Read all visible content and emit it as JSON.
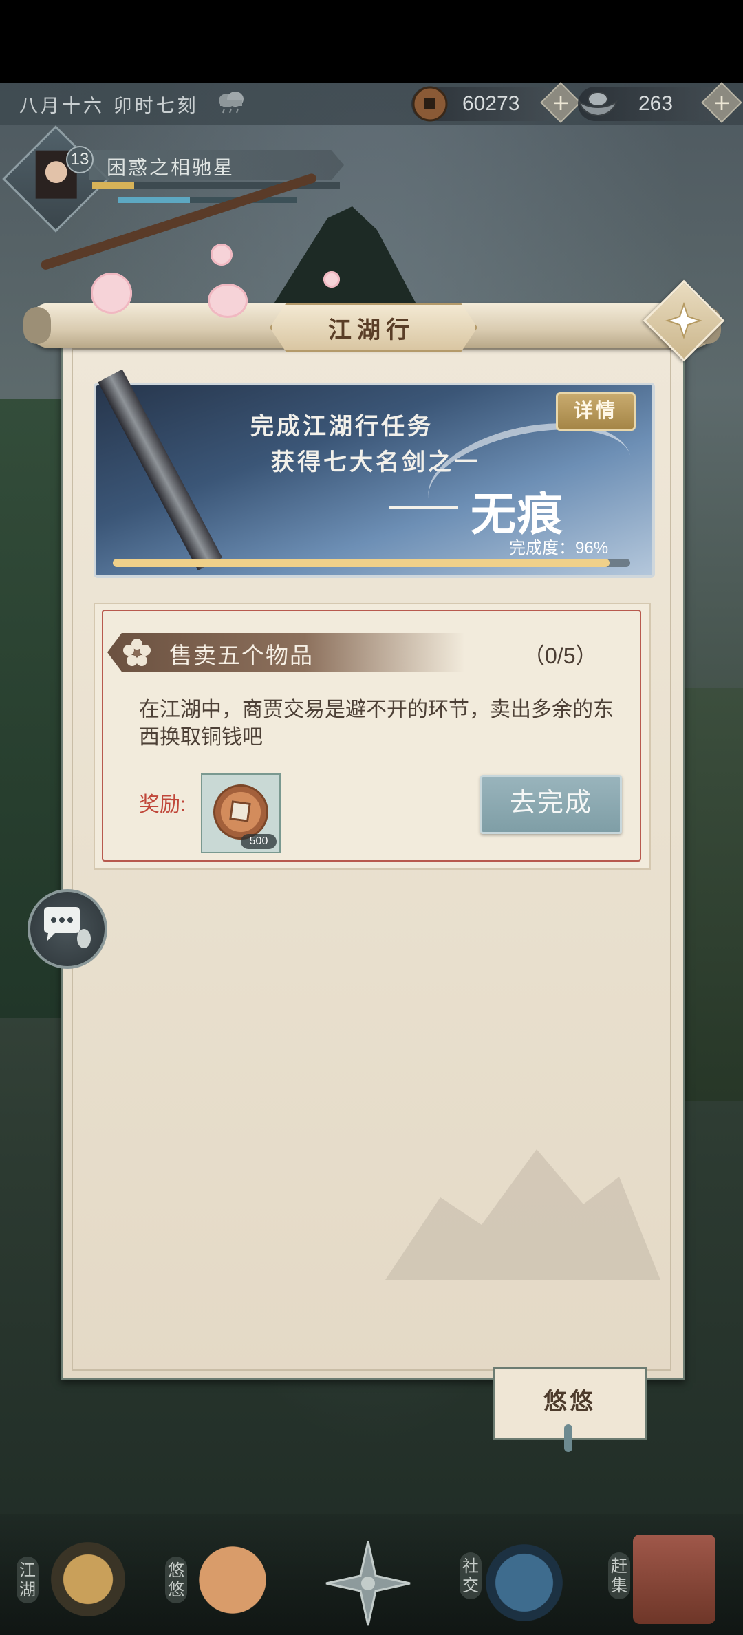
{
  "status_bar": {
    "date_text": "八月十六  卯时七刻",
    "weather_icon": "cloud-rain-icon",
    "copper_coins": "60273",
    "silver_ingots": "263",
    "plus_symbol": "+"
  },
  "player": {
    "level": "13",
    "name": "困惑之相驰星",
    "xp_fraction": 0.17,
    "hp_fraction": 0.4
  },
  "panel": {
    "title": "江湖行",
    "close_icon": "close-icon"
  },
  "banner": {
    "line1": "完成江湖行任务",
    "line2": "获得七大名剑之一",
    "sword_name": "无痕",
    "detail_button": "详情",
    "progress_label": "完成度：96%",
    "progress_fraction": 0.96
  },
  "task": {
    "title": "售卖五个物品",
    "count": "（0/5）",
    "description": "在江湖中，商贾交易是避不开的环节，卖出多余的东西换取铜钱吧",
    "reward_label": "奖励:",
    "reward_count": "500",
    "go_button": "去完成"
  },
  "tab": {
    "label": "悠悠"
  },
  "bottom_nav": [
    {
      "label": "江湖"
    },
    {
      "label": "悠悠"
    },
    {
      "label": "社交"
    },
    {
      "label": "赶集"
    }
  ],
  "colors": {
    "accent_gold": "#d7b258",
    "task_red": "#c0473a",
    "button_teal": "#8aa8b0"
  }
}
